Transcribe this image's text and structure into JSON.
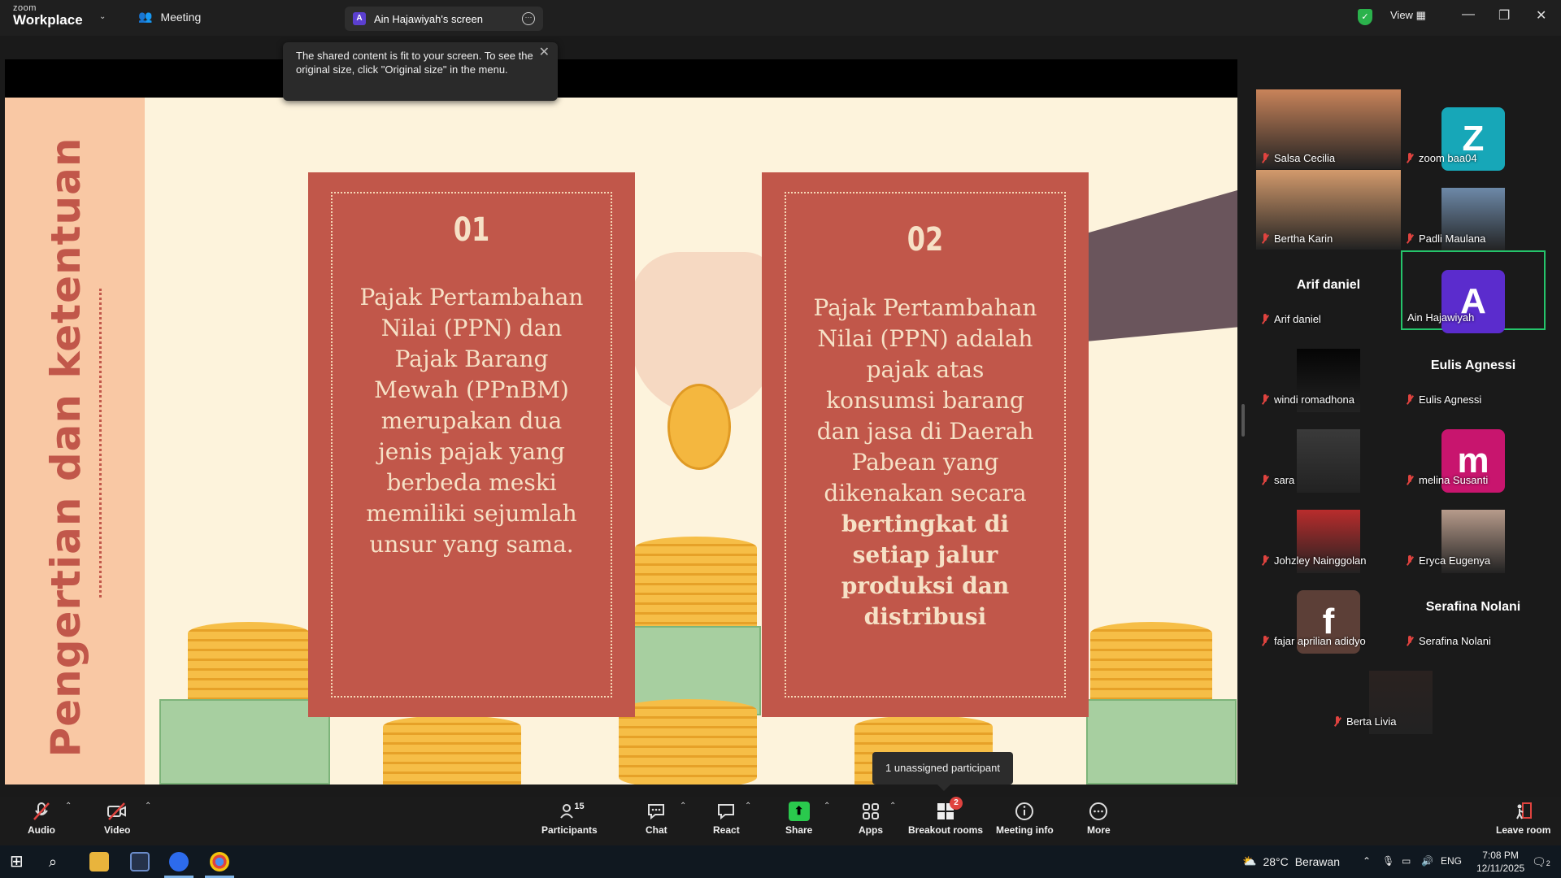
{
  "titlebar": {
    "logo_top": "zoom",
    "logo_bottom": "Workplace",
    "meeting_tab": "Meeting",
    "screen_tab": "Ain Hajawiyah's screen",
    "screen_tab_avatar": "A",
    "view_label": "View",
    "tooltip": "The shared content is fit to your screen. To see the original size, click \"Original size\" in the menu."
  },
  "slide": {
    "side_title": "Pengertian dan ketentuan",
    "card1": {
      "number": "01",
      "text": "Pajak Pertambahan Nilai (PPN) dan Pajak Barang Mewah (PPnBM) merupakan dua jenis pajak yang berbeda meski memiliki sejumlah unsur yang sama."
    },
    "card2": {
      "number": "02",
      "text": "Pajak Pertambahan Nilai (PPN) adalah pajak atas konsumsi barang dan jasa di Daerah Pabean yang dikenakan secara",
      "bold_text": "bertingkat di setiap jalur produksi dan distribusi"
    }
  },
  "participants": [
    {
      "name": "Salsa Cecilia",
      "kind": "photo",
      "color": "#c9845a"
    },
    {
      "name": "zoom baa04",
      "kind": "avatar",
      "letter": "Z",
      "color": "#17a7b8"
    },
    {
      "name": "Bertha Karin",
      "kind": "photo",
      "color": "#d39a6c"
    },
    {
      "name": "Padli Maulana",
      "kind": "photo",
      "color": "#6d89a8"
    },
    {
      "name": "Arif daniel",
      "kind": "name"
    },
    {
      "name": "Ain Hajawiyah",
      "kind": "avatar",
      "letter": "A",
      "color": "#5b2ccd",
      "active": true
    },
    {
      "name": "windi romadhona",
      "kind": "photo",
      "color": "#050505"
    },
    {
      "name": "Eulis Agnessi",
      "kind": "name"
    },
    {
      "name": "sara",
      "kind": "photo",
      "color": "#3a3a3a"
    },
    {
      "name": "melina Susanti",
      "kind": "avatar",
      "letter": "m",
      "color": "#c8156e"
    },
    {
      "name": "Johzley Nainggolan",
      "kind": "photo",
      "color": "#b92c2c"
    },
    {
      "name": "Eryca Eugenya",
      "kind": "photo",
      "color": "#b79b8b"
    },
    {
      "name": "fajar aprilian adidyo",
      "kind": "avatar",
      "letter": "f",
      "color": "#5c3f37"
    },
    {
      "name": "Serafina Nolani",
      "kind": "name"
    },
    {
      "name": "Berta Livia",
      "kind": "photo",
      "color": "#2a2220"
    }
  ],
  "unassigned": "1 unassigned participant",
  "toolbar": {
    "audio": "Audio",
    "video": "Video",
    "participants": "Participants",
    "participants_count": "15",
    "chat": "Chat",
    "react": "React",
    "share": "Share",
    "apps": "Apps",
    "breakout": "Breakout rooms",
    "breakout_badge": "2",
    "meeting_info": "Meeting info",
    "more": "More",
    "leave": "Leave room"
  },
  "taskbar": {
    "temperature": "28°C",
    "weather_text": "Berawan",
    "lang": "ENG",
    "time": "7:08 PM",
    "date": "12/11/2025",
    "notif_count": "2"
  }
}
